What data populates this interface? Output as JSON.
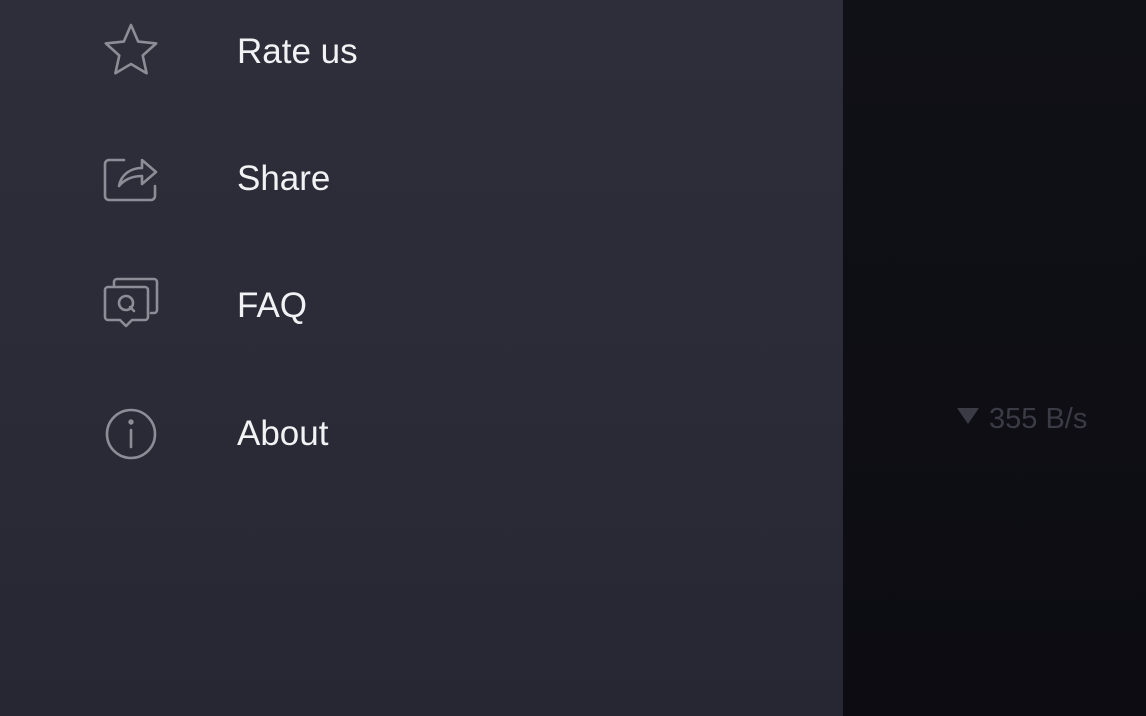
{
  "drawer": {
    "items": [
      {
        "label": "Rate us",
        "icon": "star-icon"
      },
      {
        "label": "Share",
        "icon": "share-icon"
      },
      {
        "label": "FAQ",
        "icon": "faq-icon"
      },
      {
        "label": "About",
        "icon": "info-icon"
      }
    ]
  },
  "background": {
    "download_speed": "355 B/s",
    "speed_icon": "download-arrow-icon"
  },
  "colors": {
    "drawer_bg": "#2e2e3a",
    "label_text": "#f2f2f5",
    "icon_stroke": "#8c8d96",
    "backdrop": "#0e0e15",
    "dimmed_text": "#3b3b45"
  }
}
